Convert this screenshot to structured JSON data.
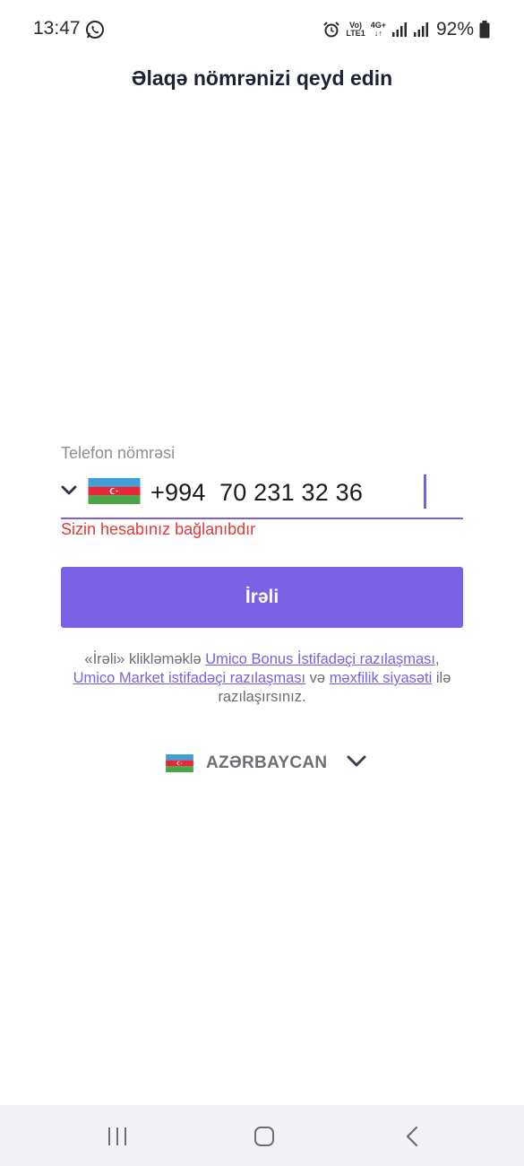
{
  "status_bar": {
    "time": "13:47",
    "volte_top": "Vo)",
    "volte_bottom": "LTE1",
    "network_top": "4G+",
    "network_bottom": "↓↑",
    "battery_percent": "92%",
    "icons": [
      "whatsapp-icon",
      "alarm-icon",
      "signal-icon",
      "battery-icon"
    ]
  },
  "header": {
    "title": "Əlaqə nömrənizi qeyd edin"
  },
  "phone_form": {
    "label": "Telefon nömrəsi",
    "value": "+994  70 231 32 36",
    "error": "Sizin hesabınız bağlanıbdır",
    "country_flag": "azerbaijan-flag-icon"
  },
  "actions": {
    "next_label": "İrəli"
  },
  "terms": {
    "prefix": "«İrəli» klikləməklə ",
    "link_bonus": "Umico Bonus İstifadəçi razılaşması",
    "comma": ",",
    "link_market": "Umico Market istifadəçi razılaşması",
    "and": " və ",
    "link_privacy": "məxfilik siyasəti",
    "suffix": " ilə razılaşırsınız."
  },
  "language": {
    "label": "AZƏRBAYCAN"
  },
  "colors": {
    "accent": "#7b61e4",
    "error": "#e03a3a",
    "flag_blue": "#3f9fd6",
    "flag_red": "#e4283a",
    "flag_green": "#4aa747"
  }
}
